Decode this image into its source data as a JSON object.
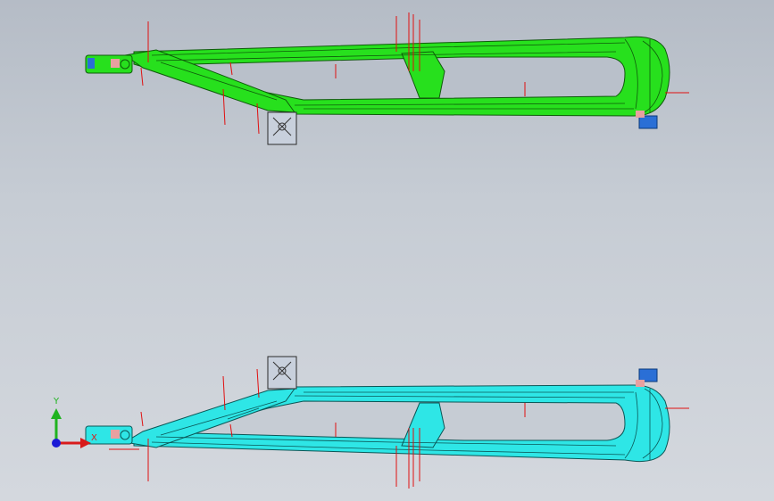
{
  "viewport": {
    "background_top": "#b5bcc6",
    "background_bottom": "#d4d8de"
  },
  "parts": [
    {
      "name": "upper-frame",
      "color": "#27e01d",
      "edge_color": "#0f5a0b"
    },
    {
      "name": "lower-frame",
      "color": "#2ee6e6",
      "edge_color": "#0b5656"
    }
  ],
  "triad": {
    "y_label": "Y",
    "x_label": "X",
    "y_color": "#1fb31f",
    "x_color": "#d81b1b",
    "origin_color": "#1a1ad6"
  },
  "colors": {
    "dimension_line": "#e01010",
    "detail_blue": "#2a6fd6",
    "detail_pink": "#e8a0a0",
    "mount_plate": "#c8d0dc"
  }
}
